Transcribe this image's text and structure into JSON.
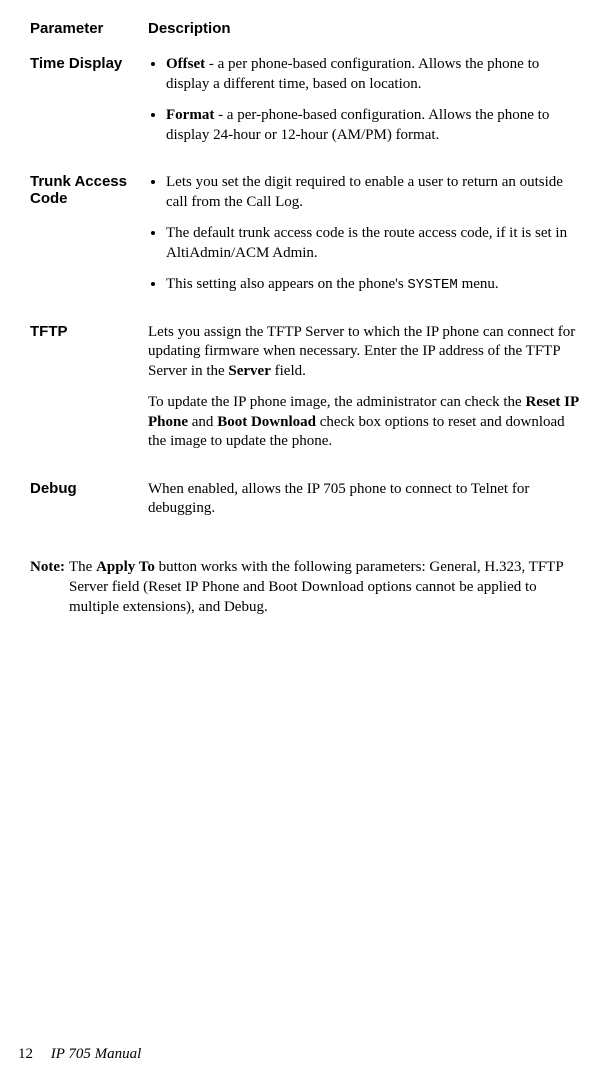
{
  "table": {
    "headers": {
      "parameter": "Parameter",
      "description": "Description"
    },
    "rows": [
      {
        "param": "Time Display",
        "bullets": [
          {
            "lead_bold": "Offset",
            "text": " - a per phone-based configuration. Allows the phone to display a different time, based on location."
          },
          {
            "lead_bold": "Format",
            "text": " - a per-phone-based configuration. Allows the phone to display 24-hour or 12-hour (AM/PM) format."
          }
        ]
      },
      {
        "param": "Trunk Access Code",
        "bullets": [
          {
            "text": "Lets you set the digit required to enable a user to return an outside call from the Call Log."
          },
          {
            "text": "The default trunk access code is the route access code, if it is set in AltiAdmin/ACM Admin."
          },
          {
            "text_pre": "This setting also appears on the phone's ",
            "mono": "SYSTEM",
            "text_post": " menu."
          }
        ]
      },
      {
        "param": "TFTP",
        "paras": [
          {
            "t1": "Lets you assign the TFTP Server to which the IP phone can connect for updating firmware when necessary. Enter the IP address of the TFTP Server in the ",
            "b1": "Server",
            "t2": " field."
          },
          {
            "t1": "To update the IP phone image, the administrator can check the ",
            "b1": "Reset IP Phone",
            "t2": " and ",
            "b2": "Boot Download",
            "t3": " check box options to reset and download the image to update the phone."
          }
        ]
      },
      {
        "param": "Debug",
        "paras": [
          {
            "t1": "When enabled, allows the IP 705 phone to connect to Telnet for debugging."
          }
        ]
      }
    ]
  },
  "note": {
    "label": "Note:",
    "t1": "The ",
    "b1": "Apply To",
    "t2": " button works with the following parameters: General, H.323, TFTP Server field (Reset IP Phone and Boot Download options cannot be applied to multiple extensions), and Debug."
  },
  "footer": {
    "page": "12",
    "manual": "IP 705 Manual"
  }
}
